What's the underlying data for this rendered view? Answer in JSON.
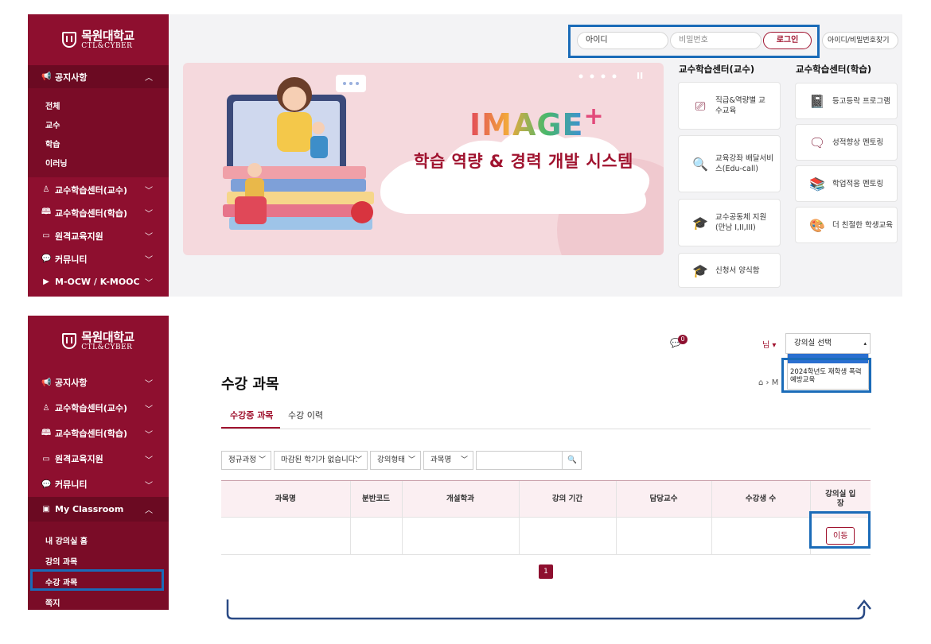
{
  "logo": {
    "name_ko": "목원대학교",
    "name_en": "CTL&CYBER"
  },
  "top": {
    "sidebar": {
      "notice": {
        "label": "공지사항",
        "sub": [
          "전체",
          "교수",
          "학습",
          "이러닝"
        ]
      },
      "items": [
        {
          "label": "교수학습센터(교수)",
          "icon": "person-icon"
        },
        {
          "label": "교수학습센터(학습)",
          "icon": "book-icon"
        },
        {
          "label": "원격교육지원",
          "icon": "monitor-icon"
        },
        {
          "label": "커뮤니티",
          "icon": "chat-icon"
        },
        {
          "label": "M-OCW / K-MOOC",
          "icon": "play-icon"
        }
      ]
    },
    "login": {
      "id_placeholder": "아이디",
      "pw_placeholder": "비밀번호",
      "login_label": "로그인",
      "find_label": "아이디/비밀번호찾기"
    },
    "banner": {
      "brand": "IMAGE",
      "brand_plus": "+",
      "tagline": "학습 역량 & 경력 개발 시스템",
      "pause": "II"
    },
    "professor_col": {
      "title": "교수학습센터(교수)",
      "cards": [
        {
          "label": "직급&역량별 교수교육",
          "icon": "presentation-icon"
        },
        {
          "label": "교육강좌 배달서비스(Edu-call)",
          "icon": "search-doc-icon"
        },
        {
          "label": "교수공동체 지원 (만남 I,II,III)",
          "icon": "grad-cap-icon"
        },
        {
          "label": "신청서 양식함",
          "icon": "grad-cap-icon"
        }
      ]
    },
    "student_col": {
      "title": "교수학습센터(학습)",
      "cards": [
        {
          "label": "등고등락 프로그램",
          "icon": "notebook-icon"
        },
        {
          "label": "성적향상 멘토링",
          "icon": "speech-icon"
        },
        {
          "label": "학업적응 멘토링",
          "icon": "books-icon"
        },
        {
          "label": "더 친절한 학생교육",
          "icon": "palette-icon"
        }
      ]
    }
  },
  "bottom": {
    "sidebar": {
      "items": [
        {
          "label": "공지사항",
          "icon": "megaphone-icon"
        },
        {
          "label": "교수학습센터(교수)",
          "icon": "person-icon"
        },
        {
          "label": "교수학습센터(학습)",
          "icon": "book-icon"
        },
        {
          "label": "원격교육지원",
          "icon": "monitor-icon"
        },
        {
          "label": "커뮤니티",
          "icon": "chat-icon"
        }
      ],
      "classroom": {
        "label": "My Classroom",
        "sub": [
          "내 강의실 홈",
          "강의 과목",
          "수강 과목",
          "쪽지"
        ]
      }
    },
    "header": {
      "msg_count": "0",
      "user_suffix": "님",
      "room_select": "강의실 선택",
      "room_option": "2024학년도 재학생 폭력예방교육"
    },
    "page_title": "수강 과목",
    "breadcrumb_home": "⌂",
    "breadcrumb_rest": "M",
    "tabs": [
      "수강중 과목",
      "수강 이력"
    ],
    "filters": [
      "정규과정",
      "마감된 학기가 없습니다.",
      "강의형태",
      "과목명"
    ],
    "table": {
      "headers": [
        "과목명",
        "분반코드",
        "개설학과",
        "강의 기간",
        "담당교수",
        "수강생 수",
        "강의실 입장"
      ],
      "move_label": "이동"
    },
    "page_number": "1"
  },
  "colors": {
    "brand": "#8e0f2f",
    "highlight": "#1a6bb8"
  }
}
